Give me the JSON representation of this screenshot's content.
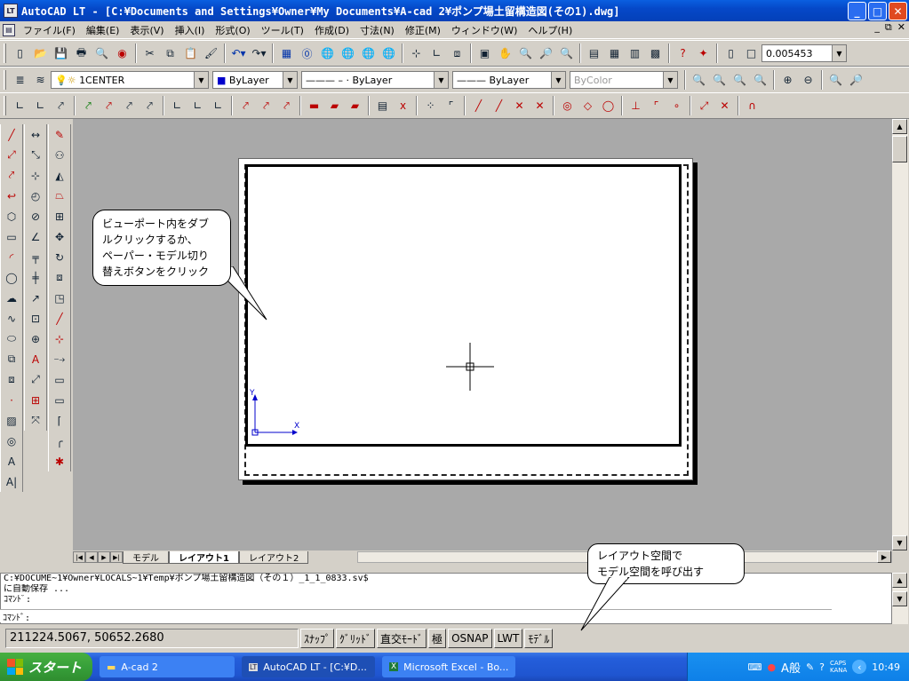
{
  "window": {
    "title": "AutoCAD LT - [C:¥Documents and Settings¥Owner¥My Documents¥A-cad 2¥ポンプ場土留構造図(その1).dwg]",
    "minimize": "_",
    "maximize": "□",
    "close": "✕"
  },
  "menu": {
    "items": [
      "ファイル(F)",
      "編集(E)",
      "表示(V)",
      "挿入(I)",
      "形式(O)",
      "ツール(T)",
      "作成(D)",
      "寸法(N)",
      "修正(M)",
      "ウィンドウ(W)",
      "ヘルプ(H)"
    ],
    "doc_controls": [
      "_",
      "⧉",
      "✕"
    ]
  },
  "toolbar": {
    "scale_value": "0.005453",
    "layer_value": "1CENTER",
    "color_value": "ByLayer",
    "linetype_value": "ByLayer",
    "lineweight_value": "ByLayer",
    "plotstyle_value": "ByColor"
  },
  "canvas": {
    "callout_lines": [
      "ビューポート内をダブ",
      "ルクリックするか、",
      "ペーパー・モデル切り",
      "替えボタンをクリック"
    ],
    "ucs_x": "X",
    "ucs_y": "Y"
  },
  "layout_tabs": [
    "モデル",
    "レイアウト1",
    "レイアウト2"
  ],
  "layout_callout": [
    "レイアウト空間で",
    "モデル空間を呼び出す"
  ],
  "command": {
    "lines": [
      "C:¥DOCUME~1¥Owner¥LOCALS~1¥Temp¥ポンプ場土留構造図（その１）_1_1_0833.sv$",
      "に自動保存 ...",
      "ｺﾏﾝﾄﾞ:"
    ],
    "prompt": "ｺﾏﾝﾄﾞ:"
  },
  "status": {
    "coords": "211224.5067, 50652.2680",
    "buttons": [
      "ｽﾅｯﾌﾟ",
      "ｸﾞﾘｯﾄﾞ",
      "直交ﾓｰﾄﾞ",
      "極",
      "OSNAP",
      "LWT",
      "ﾓﾃﾞﾙ"
    ]
  },
  "taskbar": {
    "start": "スタート",
    "tasks": [
      "A-cad 2",
      "AutoCAD LT - [C:¥D...",
      "Microsoft Excel - Bo..."
    ],
    "ime": "A般",
    "caps": "CAPS",
    "kana": "KANA",
    "clock": "10:49"
  }
}
